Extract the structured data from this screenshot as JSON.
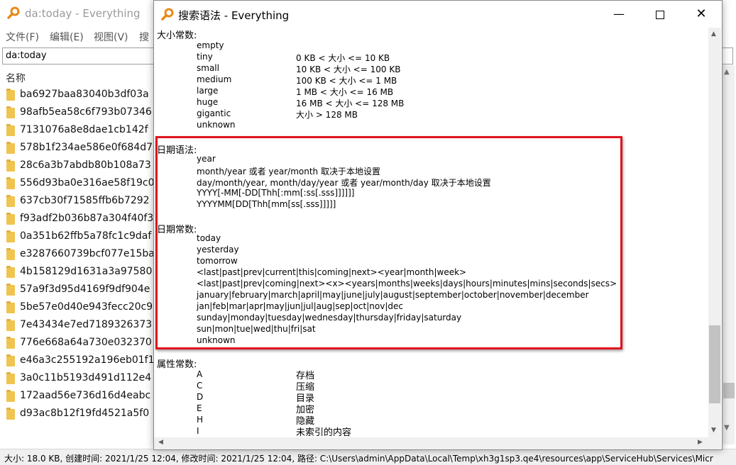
{
  "background_window": {
    "title": "da:today - Everything",
    "menus": [
      "文件(F)",
      "编辑(E)",
      "视图(V)",
      "搜"
    ],
    "search_value": "da:today",
    "column_header": "名称",
    "rows": [
      "ba6927baa83040b3df03a",
      "98afb5ea58c6f793b07346",
      "7131076a8e8dae1cb142f",
      "578b1f234ae586e0f684d7",
      "28c6a3b7abdb80b108a73",
      "556d93ba0e316ae58f19c0",
      "637cb30f71585ffb6b7292",
      "f93adf2b036b87a304f40f3",
      "0a351b62ffb5a78fc1c9daf",
      "e3287660739bcf077e15ba",
      "4b158129d1631a3a97580",
      "57a9f3d95d4169f9df904e",
      "5be57e0d40e943fecc20c9",
      "7e43434e7ed7189326373",
      "776e668a64a730e032370",
      "e46a3c255192a196eb01f1",
      "3a0c11b5193d491d112e4",
      "172aad56e736d16d4eabc",
      "d93ac8b12f19fd4521a5f0"
    ],
    "status": "大小: 18.0 KB, 创建时间: 2021/1/25 12:04, 修改时间: 2021/1/25 12:04, 路径: C:\\Users\\admin\\AppData\\Local\\Temp\\xh3g1sp3.qe4\\resources\\app\\ServiceHub\\Services\\Micr"
  },
  "dialog": {
    "title": "搜索语法 - Everything",
    "size_constants": {
      "heading": "大小常数:",
      "items": [
        {
          "name": "empty",
          "value": ""
        },
        {
          "name": "tiny",
          "value": "0 KB < 大小 <= 10 KB"
        },
        {
          "name": "small",
          "value": "10 KB < 大小 <= 100 KB"
        },
        {
          "name": "medium",
          "value": "100 KB < 大小 <= 1 MB"
        },
        {
          "name": "large",
          "value": "1 MB < 大小 <= 16 MB"
        },
        {
          "name": "huge",
          "value": "16 MB < 大小 <= 128 MB"
        },
        {
          "name": "gigantic",
          "value": "大小 > 128 MB"
        },
        {
          "name": "unknown",
          "value": ""
        }
      ]
    },
    "date_syntax": {
      "heading": "日期语法:",
      "items": [
        "year",
        "month/year 或者 year/month 取决于本地设置",
        "day/month/year, month/day/year 或者 year/month/day 取决于本地设置",
        "YYYY[-MM[-DD[Thh[:mm[:ss[.sss]]]]]]",
        "YYYYMM[DD[Thh[mm[ss[.sss]]]]]"
      ]
    },
    "date_constants": {
      "heading": "日期常数:",
      "items": [
        "today",
        "yesterday",
        "tomorrow",
        "<last|past|prev|current|this|coming|next><year|month|week>",
        "<last|past|prev|coming|next><x><years|months|weeks|days|hours|minutes|mins|seconds|secs>",
        "january|february|march|april|may|june|july|august|september|october|november|december",
        "jan|feb|mar|apr|may|jun|jul|aug|sep|oct|nov|dec",
        "sunday|monday|tuesday|wednesday|thursday|friday|saturday",
        "sun|mon|tue|wed|thu|fri|sat",
        "unknown"
      ]
    },
    "attribute_constants": {
      "heading": "属性常数:",
      "items": [
        {
          "name": "A",
          "value": "存档"
        },
        {
          "name": "C",
          "value": "压缩"
        },
        {
          "name": "D",
          "value": "目录"
        },
        {
          "name": "E",
          "value": "加密"
        },
        {
          "name": "H",
          "value": "隐藏"
        },
        {
          "name": "I",
          "value": "未索引的内容"
        }
      ]
    }
  },
  "colors": {
    "highlight_border": "#e0141e",
    "folder": "#f0c450",
    "title_inactive": "#9a9a9a"
  },
  "icons": {
    "app": "magnifier-icon",
    "folder": "folder-icon"
  }
}
